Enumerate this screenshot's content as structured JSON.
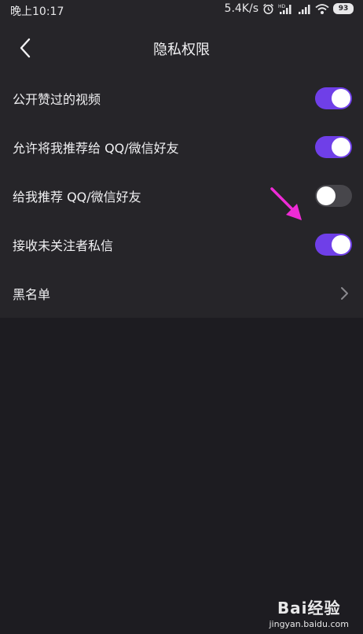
{
  "status_bar": {
    "time": "晚上10:17",
    "speed": "5.4K/s",
    "battery": "93"
  },
  "header": {
    "title": "隐私权限"
  },
  "settings": [
    {
      "label": "公开赞过的视频",
      "toggle": "on"
    },
    {
      "label": "允许将我推荐给 QQ/微信好友",
      "toggle": "on"
    },
    {
      "label": "给我推荐 QQ/微信好友",
      "toggle": "off"
    },
    {
      "label": "接收未关注者私信",
      "toggle": "on"
    },
    {
      "label": "黑名单",
      "toggle": null
    }
  ],
  "watermark": {
    "logo_text": "Bai经验",
    "url": "jingyan.baidu.com"
  },
  "colors": {
    "toggle_on": "#6f3fe8",
    "toggle_off": "#47464b",
    "annotation_arrow": "#ee2bd6"
  }
}
